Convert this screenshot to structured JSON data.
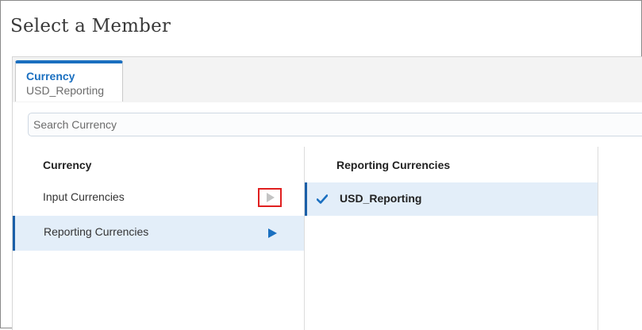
{
  "dialog": {
    "title": "Select a Member"
  },
  "tab": {
    "label": "Currency",
    "value": "USD_Reporting"
  },
  "search": {
    "placeholder": "Search Currency"
  },
  "hierarchy": {
    "header": "Currency",
    "items": [
      {
        "label": "Input Currencies",
        "selected": false,
        "icon": "drill-arrow-icon"
      },
      {
        "label": "Reporting Currencies",
        "selected": true,
        "icon": "drill-arrow-icon"
      }
    ]
  },
  "members": {
    "header": "Reporting Currencies",
    "items": [
      {
        "label": "USD_Reporting",
        "checked": true,
        "icon": "check-icon"
      }
    ]
  },
  "colors": {
    "accent": "#1a6fc0",
    "selection_bg": "#e3eef9",
    "highlight_box": "#e02020"
  }
}
